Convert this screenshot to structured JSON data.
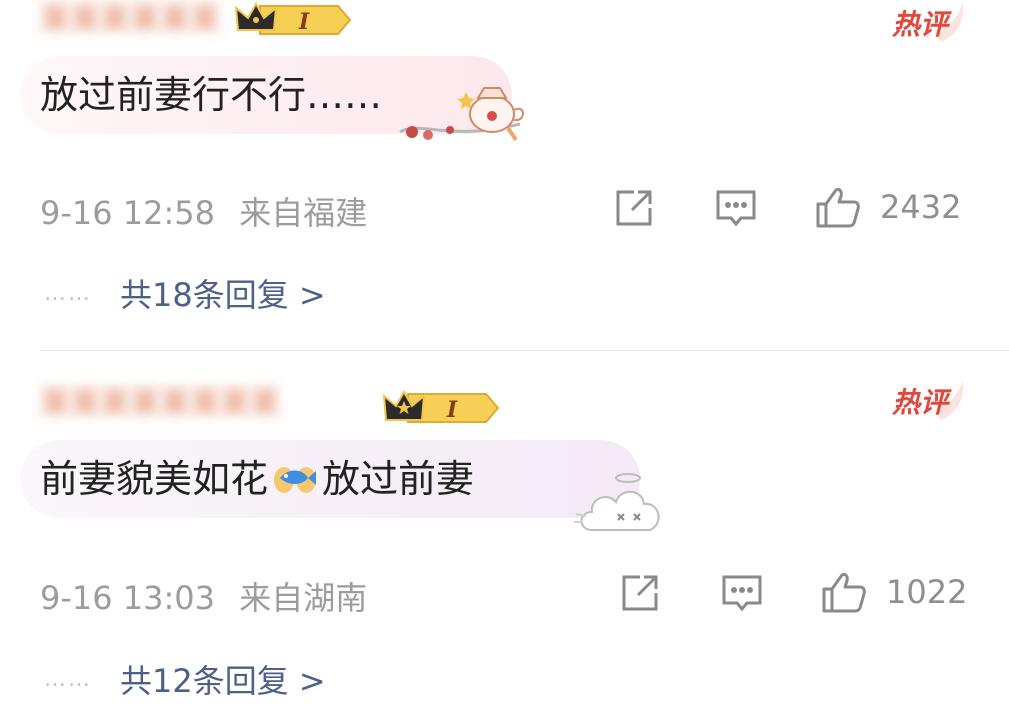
{
  "comments": [
    {
      "username": "某某某某某某",
      "hot_label": "热评",
      "badge_level": "I",
      "text": "放过前妻行不行……",
      "time": "9-16 12:58",
      "location": "来自福建",
      "likes": "2432",
      "reply_text": "共18条回复 >",
      "dots": "……"
    },
    {
      "username": "某某某某某某某某",
      "hot_label": "热评",
      "badge_level": "I",
      "text_before": "前妻貌美如花",
      "text_after": "放过前妻",
      "time": "9-16 13:03",
      "location": "来自湖南",
      "likes": "1022",
      "reply_text": "共12条回复 >",
      "dots": "……"
    }
  ],
  "colors": {
    "hot": "#e3463a",
    "reply_link": "#4d6089",
    "meta": "#9c9c9c",
    "badge": "#f3c54a"
  },
  "icons": [
    "share-icon",
    "comment-icon",
    "like-icon",
    "crown-icon",
    "teapot-sticker",
    "cloud-sticker",
    "fish-hands-emoji"
  ]
}
